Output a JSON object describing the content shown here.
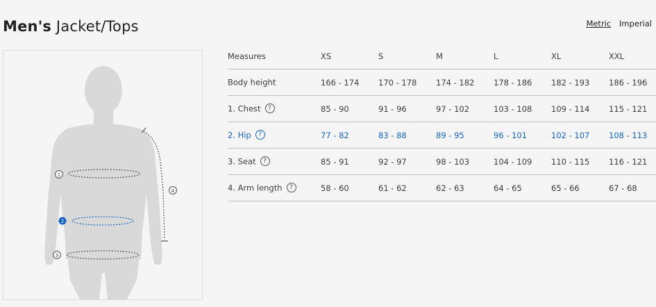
{
  "title": {
    "bold": "Men's",
    "light": "Jacket/Tops"
  },
  "units": {
    "metric": "Metric",
    "imperial": "Imperial"
  },
  "figure": {
    "markers": [
      "1",
      "2",
      "3",
      "4"
    ]
  },
  "table": {
    "headers": [
      "Measures",
      "XS",
      "S",
      "M",
      "L",
      "XL",
      "XXL"
    ],
    "help_glyph": "?",
    "rows": [
      {
        "label": "Body height",
        "help": false,
        "highlight": false,
        "values": [
          "166 - 174",
          "170 - 178",
          "174 - 182",
          "178 - 186",
          "182 - 193",
          "186 - 196"
        ]
      },
      {
        "label": "1. Chest",
        "help": true,
        "highlight": false,
        "values": [
          "85 - 90",
          "91 - 96",
          "97 - 102",
          "103 - 108",
          "109 - 114",
          "115 - 121"
        ]
      },
      {
        "label": "2. Hip",
        "help": true,
        "highlight": true,
        "values": [
          "77 - 82",
          "83 - 88",
          "89 - 95",
          "96 - 101",
          "102 - 107",
          "108 - 113"
        ]
      },
      {
        "label": "3. Seat",
        "help": true,
        "highlight": false,
        "values": [
          "85 - 91",
          "92 - 97",
          "98 - 103",
          "104 - 109",
          "110 - 115",
          "116 - 121"
        ]
      },
      {
        "label": "4. Arm length",
        "help": true,
        "highlight": false,
        "values": [
          "58 - 60",
          "61 - 62",
          "62 - 63",
          "64 - 65",
          "65 - 66",
          "67 - 68"
        ]
      }
    ]
  },
  "colors": {
    "highlight": "#1565c0",
    "silhouette": "#d9d9d9",
    "text": "#3c3c3c"
  }
}
